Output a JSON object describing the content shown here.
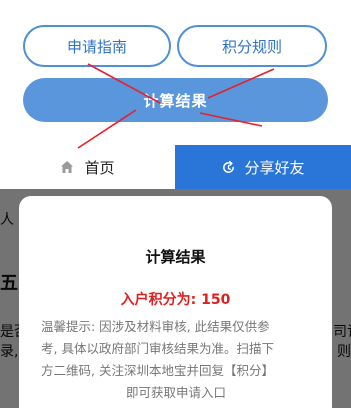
{
  "top_buttons": {
    "guide_label": "申请指南",
    "rules_label": "积分规则"
  },
  "calc_button": {
    "label": "计算结果"
  },
  "nav": {
    "home_label": "首页",
    "share_label": "分享好友"
  },
  "background_article": {
    "line1": "人",
    "line2": "五",
    "line3": "是否",
    "line3_right": "司记",
    "line4": "录,",
    "line4_right": "则"
  },
  "dialog": {
    "title": "计算结果",
    "score_text": "入户积分为: 150",
    "tip_lines": [
      "温馨提示: 因涉及材料审核, 此结果仅供参",
      "考, 具体以政府部门审核结果为准。扫描下",
      "方二维码, 关注深圳本地宝并回复【积分】",
      "即可获取申请入口"
    ]
  },
  "colors": {
    "primary_blue": "#2a76d8",
    "button_blue": "#5a96dc",
    "outline_blue": "#4e8fd6",
    "score_red": "#e02020",
    "annotation_red": "#e8202a"
  }
}
